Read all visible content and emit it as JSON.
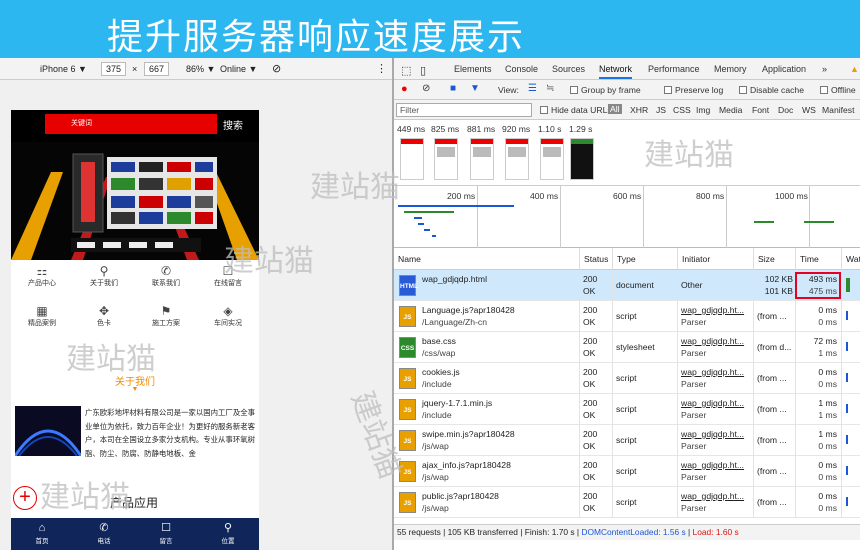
{
  "banner": {
    "title": "提升服务器响应速度展示"
  },
  "device_toolbar": {
    "device": "iPhone 6 ▼",
    "width": "375",
    "times": "×",
    "height": "667",
    "zoom": "86% ▼",
    "network": "Online ▼"
  },
  "phone": {
    "search_placeholder": "关键词",
    "search_button": "搜索",
    "icons": [
      {
        "label": "产品中心",
        "glyph": "⚏"
      },
      {
        "label": "关于我们",
        "glyph": "⚲"
      },
      {
        "label": "联系我们",
        "glyph": "✆"
      },
      {
        "label": "在线留言",
        "glyph": "☐"
      },
      {
        "label": "精品案例",
        "glyph": "▦"
      },
      {
        "label": "色卡",
        "glyph": "✥"
      },
      {
        "label": "施工方案",
        "glyph": "⚑"
      },
      {
        "label": "车间实况",
        "glyph": "◈"
      }
    ],
    "about_title": "关于我们",
    "news_text": "广东欧彩地坪材料有限公司是一家以国内工厂及全事业单位为依托，致力百年企业！为更好的服务新老客户，本司在全国设立多家分支机构。专业从事环氧树脂、防尘、防腐、防静电地板、金",
    "product_title": "产品应用",
    "plus": "+",
    "tabs": [
      {
        "label": "首页",
        "glyph": "⌂"
      },
      {
        "label": "电话",
        "glyph": "✆"
      },
      {
        "label": "留言",
        "glyph": "☐"
      },
      {
        "label": "位置",
        "glyph": "⚲"
      }
    ]
  },
  "devtools": {
    "tabs": [
      "Elements",
      "Console",
      "Sources",
      "Network",
      "Performance",
      "Memory",
      "Application",
      "»"
    ],
    "active_tab": "Network",
    "toolbar": {
      "view": "View:",
      "group_by_frame": "Group by frame",
      "preserve_log": "Preserve log",
      "disable_cache": "Disable cache",
      "offline": "Offline"
    },
    "filter": {
      "placeholder": "Filter",
      "hide_data_urls": "Hide data URLs",
      "types": [
        "All",
        "XHR",
        "JS",
        "CSS",
        "Img",
        "Media",
        "Font",
        "Doc",
        "WS",
        "Manifest"
      ]
    },
    "filmstrip_times": [
      "449 ms",
      "825 ms",
      "881 ms",
      "920 ms",
      "1.10 s",
      "1.29 s"
    ],
    "overview_labels": [
      "200 ms",
      "400 ms",
      "600 ms",
      "800 ms",
      "1000 ms"
    ],
    "columns": [
      "Name",
      "Status",
      "Type",
      "Initiator",
      "Size",
      "Time",
      "Wat"
    ],
    "rows": [
      {
        "name": "wap_gdjqdp.html",
        "path": "",
        "status": "200",
        "status2": "OK",
        "type": "document",
        "initiator": "Other",
        "initiator2": "",
        "size": "102 KB",
        "size2": "101 KB",
        "time": "493 ms",
        "time2": "475 ms",
        "icon": "HTML"
      },
      {
        "name": "Language.js?apr180428",
        "path": "/Language/Zh-cn",
        "status": "200",
        "status2": "OK",
        "type": "script",
        "initiator": "wap_gdjqdp.ht...",
        "initiator2": "Parser",
        "size": "(from ...",
        "size2": "",
        "time": "0 ms",
        "time2": "0 ms",
        "icon": "JS"
      },
      {
        "name": "base.css",
        "path": "/css/wap",
        "status": "200",
        "status2": "OK",
        "type": "stylesheet",
        "initiator": "wap_gdjqdp.ht...",
        "initiator2": "Parser",
        "size": "(from d...",
        "size2": "",
        "time": "72 ms",
        "time2": "1 ms",
        "icon": "CSS"
      },
      {
        "name": "cookies.js",
        "path": "/include",
        "status": "200",
        "status2": "OK",
        "type": "script",
        "initiator": "wap_gdjqdp.ht...",
        "initiator2": "Parser",
        "size": "(from ...",
        "size2": "",
        "time": "0 ms",
        "time2": "0 ms",
        "icon": "JS"
      },
      {
        "name": "jquery-1.7.1.min.js",
        "path": "/include",
        "status": "200",
        "status2": "OK",
        "type": "script",
        "initiator": "wap_gdjqdp.ht...",
        "initiator2": "Parser",
        "size": "(from ...",
        "size2": "",
        "time": "1 ms",
        "time2": "1 ms",
        "icon": "JS"
      },
      {
        "name": "swipe.min.js?apr180428",
        "path": "/js/wap",
        "status": "200",
        "status2": "OK",
        "type": "script",
        "initiator": "wap_gdjqdp.ht...",
        "initiator2": "Parser",
        "size": "(from ...",
        "size2": "",
        "time": "1 ms",
        "time2": "0 ms",
        "icon": "JS"
      },
      {
        "name": "ajax_info.js?apr180428",
        "path": "/js/wap",
        "status": "200",
        "status2": "OK",
        "type": "script",
        "initiator": "wap_gdjqdp.ht...",
        "initiator2": "Parser",
        "size": "(from ...",
        "size2": "",
        "time": "0 ms",
        "time2": "0 ms",
        "icon": "JS"
      },
      {
        "name": "public.js?apr180428",
        "path": "/js/wap",
        "status": "200",
        "status2": "OK",
        "type": "script",
        "initiator": "wap_gdjqdp.ht...",
        "initiator2": "Parser",
        "size": "(from ...",
        "size2": "",
        "time": "0 ms",
        "time2": "0 ms",
        "icon": "JS"
      }
    ],
    "status": {
      "requests": "55 requests",
      "transferred": "105 KB transferred",
      "finish": "Finish: 1.70 s",
      "dcl": "DOMContentLoaded: 1.56 s",
      "load": "Load: 1.60 s"
    }
  },
  "watermarks": [
    "建站猫",
    "建站猫",
    "建站猫",
    "建站猫",
    "建站猫",
    "建站猫"
  ],
  "colors": {
    "banner": "#2db7f0",
    "accent_red": "#e60000",
    "selected_row": "#cfe8fc",
    "dcl_blue": "#1a56d6",
    "load_red": "#d11"
  }
}
